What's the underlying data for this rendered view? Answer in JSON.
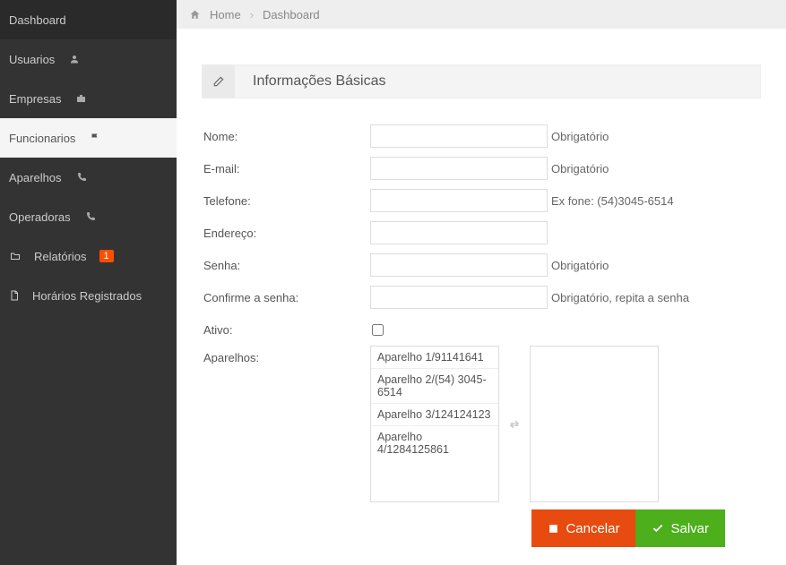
{
  "sidebar": {
    "items": [
      {
        "label": "Dashboard",
        "icon": ""
      },
      {
        "label": "Usuarios",
        "icon": "user"
      },
      {
        "label": "Empresas",
        "icon": "briefcase"
      },
      {
        "label": "Funcionarios",
        "icon": "flag",
        "active": true
      },
      {
        "label": "Aparelhos",
        "icon": "phone"
      },
      {
        "label": "Operadoras",
        "icon": "phone"
      },
      {
        "label": "Relatórios",
        "icon": "folder",
        "badge": "1"
      },
      {
        "label": "Horários Registrados",
        "icon": "file"
      }
    ]
  },
  "breadcrumb": {
    "home": "Home",
    "current": "Dashboard"
  },
  "section": {
    "title": "Informações Básicas"
  },
  "form": {
    "nome": {
      "label": "Nome:",
      "hint": "Obrigatório"
    },
    "email": {
      "label": "E-mail:",
      "hint": "Obrigatório"
    },
    "telefone": {
      "label": "Telefone:",
      "hint": "Ex fone: (54)3045-6514"
    },
    "endereco": {
      "label": "Endereço:",
      "hint": ""
    },
    "senha": {
      "label": "Senha:",
      "hint": "Obrigatório"
    },
    "confirma": {
      "label": "Confirme a senha:",
      "hint": "Obrigatório, repita a senha"
    },
    "ativo": {
      "label": "Ativo:"
    },
    "aparelhos": {
      "label": "Aparelhos:",
      "options": [
        "Aparelho 1/91141641",
        "Aparelho 2/(54) 3045-6514",
        "Aparelho 3/124124123",
        "Aparelho 4/1284125861"
      ]
    }
  },
  "buttons": {
    "cancel": "Cancelar",
    "save": "Salvar"
  }
}
